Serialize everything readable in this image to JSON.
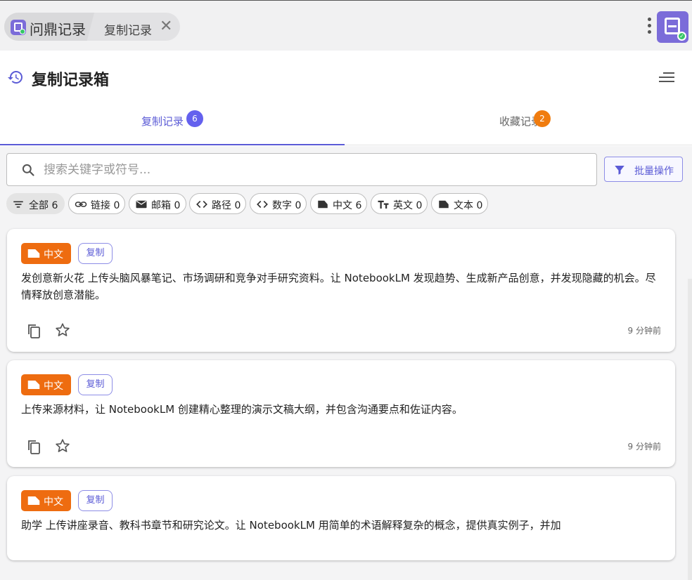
{
  "window": {
    "app_title": "问鼎记录",
    "tab_label": "复制记录",
    "close_glyph": "✕"
  },
  "header": {
    "title": "复制记录箱"
  },
  "tabs": [
    {
      "label": "复制记录 6",
      "badge": "6"
    },
    {
      "label": "收藏记录",
      "badge": "2"
    }
  ],
  "search": {
    "placeholder": "搜索关键字或符号...",
    "value": ""
  },
  "batch_button": {
    "label": "批量操作"
  },
  "filters": [
    {
      "label": "全部 6",
      "icon": "filter-icon",
      "active": true
    },
    {
      "label": "链接 0",
      "icon": "link-icon"
    },
    {
      "label": "邮箱 0",
      "icon": "mail-icon"
    },
    {
      "label": "路径 0",
      "icon": "code-icon"
    },
    {
      "label": "数字 0",
      "icon": "code-icon"
    },
    {
      "label": "中文 6",
      "icon": "label-icon"
    },
    {
      "label": "英文 0",
      "icon": "text-size-icon"
    },
    {
      "label": "文本 0",
      "icon": "label-icon"
    }
  ],
  "records": [
    {
      "type": "中文",
      "action": "复制",
      "text": "发创意新火花 上传头脑风暴笔记、市场调研和竞争对手研究资料。让 NotebookLM 发现趋势、生成新产品创意，并发现隐藏的机会。尽情释放创意潜能。",
      "time": "9 分钟前"
    },
    {
      "type": "中文",
      "action": "复制",
      "text": "上传来源材料，让 NotebookLM 创建精心整理的演示文稿大纲，并包含沟通要点和佐证内容。",
      "time": "9 分钟前"
    },
    {
      "type": "中文",
      "action": "复制",
      "text": "助学 上传讲座录音、教科书章节和研究论文。让 NotebookLM 用简单的术语解释复杂的概念，提供真实例子，并加",
      "time": ""
    }
  ],
  "colors": {
    "accent": "#5b5bd6",
    "orange": "#ee6c10",
    "badge_blue": "#6461ee",
    "badge_orange": "#f07c0f"
  }
}
